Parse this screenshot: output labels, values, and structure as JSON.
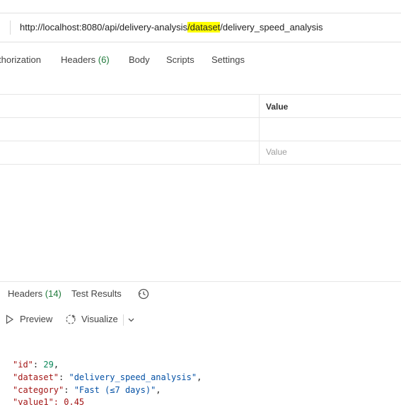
{
  "url": {
    "before": "http://localhost:8080/api/delivery-analysis",
    "highlight": "/dataset",
    "after": "/delivery_speed_analysis"
  },
  "request_tabs": {
    "authorization": "thorization",
    "headers": "Headers",
    "headers_count": "(6)",
    "body": "Body",
    "scripts": "Scripts",
    "settings": "Settings"
  },
  "params_table": {
    "value_header": "Value",
    "value_placeholder": "Value"
  },
  "response_tabs": {
    "headers": "Headers",
    "headers_count": "(14)",
    "test_results": "Test Results"
  },
  "view_tabs": {
    "preview": "Preview",
    "visualize": "Visualize"
  },
  "icons": {
    "history": "history-icon",
    "preview": "play-outline-icon",
    "visualize": "visualize-sparkle-icon",
    "dropdown": "chevron-down-icon"
  },
  "response_body": {
    "id_key": "\"id\"",
    "id_val": "29",
    "dataset_key": "\"dataset\"",
    "dataset_val": "\"delivery_speed_analysis\"",
    "category_key": "\"category\"",
    "category_val": "\"Fast (≤7 days)\"",
    "partial_line": "\"value1\": 0.45"
  }
}
